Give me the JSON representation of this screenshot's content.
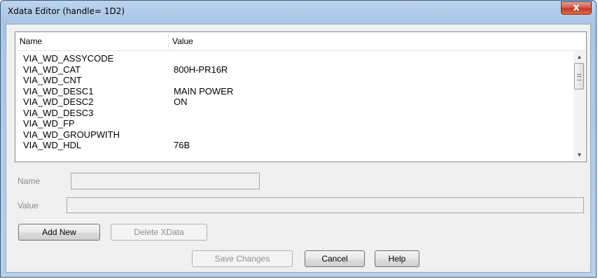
{
  "window": {
    "title": "Xdata Editor (handle= 1D2)",
    "close_glyph": "x"
  },
  "list": {
    "columns": {
      "name": "Name",
      "value": "Value"
    },
    "rows": [
      {
        "name": "VIA_WD_ASSYCODE",
        "value": ""
      },
      {
        "name": "VIA_WD_CAT",
        "value": "800H-PR16R"
      },
      {
        "name": "VIA_WD_CNT",
        "value": ""
      },
      {
        "name": "VIA_WD_DESC1",
        "value": "MAIN POWER"
      },
      {
        "name": "VIA_WD_DESC2",
        "value": "ON"
      },
      {
        "name": "VIA_WD_DESC3",
        "value": ""
      },
      {
        "name": "VIA_WD_FP",
        "value": ""
      },
      {
        "name": "VIA_WD_GROUPWITH",
        "value": ""
      },
      {
        "name": "VIA_WD_HDL",
        "value": "76B"
      }
    ]
  },
  "form": {
    "name_label": "Name",
    "value_label": "Value",
    "name_value": "",
    "value_value": ""
  },
  "buttons": {
    "add_new": "Add New",
    "delete_xdata": "Delete XData",
    "save_changes": "Save Changes",
    "cancel": "Cancel",
    "help": "Help"
  },
  "icons": {
    "scroll_up": "▲",
    "scroll_down": "▼"
  },
  "colors": {
    "title_bar": "#bcd5ee",
    "close_button": "#c13a23",
    "dialog_body": "#f0f0f0"
  }
}
